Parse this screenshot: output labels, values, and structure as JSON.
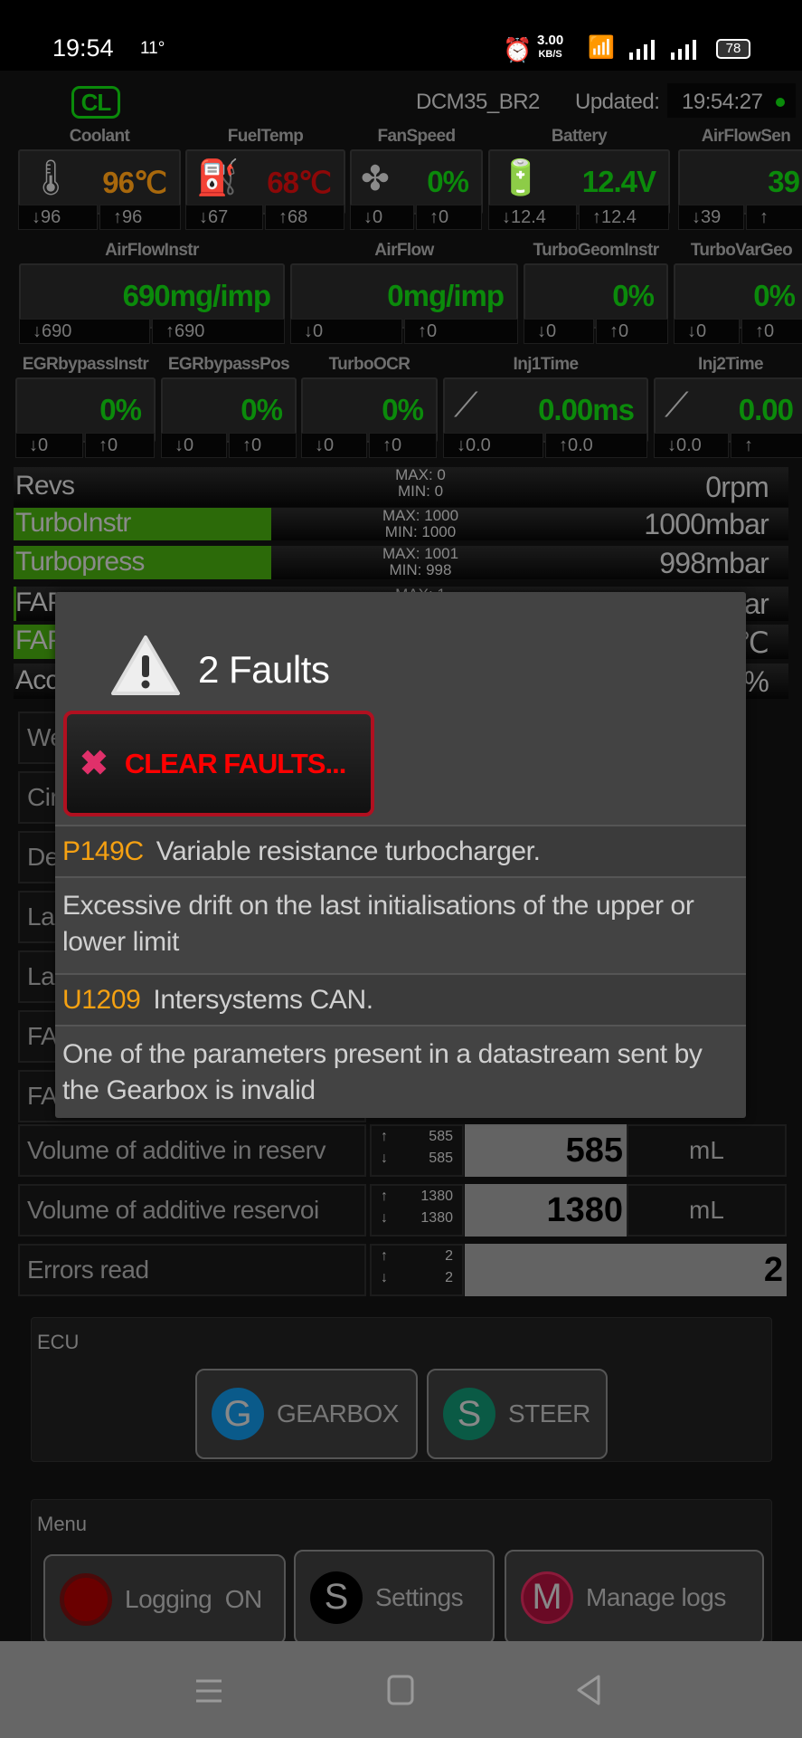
{
  "status_bar": {
    "time": "19:54",
    "temperature": "11°",
    "net_speed": "3.00",
    "net_unit": "KB/S",
    "battery": "78"
  },
  "header": {
    "logo": "CL",
    "ecu_name": "DCM35_BR2",
    "updated_label": "Updated:",
    "updated_time": "19:54:27",
    "connection_color": "#0a8a0a"
  },
  "gauges": [
    {
      "label": "Coolant",
      "value": "96℃",
      "min": "↓96",
      "max": "↑96",
      "icon": "coolant-temp-icon",
      "color": "#a8680c"
    },
    {
      "label": "FuelTemp",
      "value": "68℃",
      "min": "↓67",
      "max": "↑68",
      "icon": "fuel-pump-icon",
      "color": "#8c0808"
    },
    {
      "label": "FanSpeed",
      "value": "0%",
      "min": "↓0",
      "max": "↑0",
      "icon": "fan-icon",
      "color": "#0b8a0b"
    },
    {
      "label": "Battery",
      "value": "12.4V",
      "min": "↓12.4",
      "max": "↑12.4",
      "icon": "battery-icon",
      "color": "#0b8a0b"
    },
    {
      "label": "AirFlowSen",
      "value": "39",
      "min": "↓39",
      "max": "↑",
      "icon": "",
      "color": "#0b8a0b"
    },
    {
      "label": "AirFlowInstr",
      "value": "690mg/imp",
      "min": "↓690",
      "max": "↑690",
      "icon": "",
      "color": "#0b8a0b"
    },
    {
      "label": "AirFlow",
      "value": "0mg/imp",
      "min": "↓0",
      "max": "↑0",
      "icon": "",
      "color": "#0b8a0b"
    },
    {
      "label": "TurboGeomInstr",
      "value": "0%",
      "min": "↓0",
      "max": "↑0",
      "icon": "",
      "color": "#0b8a0b"
    },
    {
      "label": "TurboVarGeo",
      "value": "0%",
      "min": "↓0",
      "max": "↑0",
      "icon": "",
      "color": "#0b8a0b"
    },
    {
      "label": "EGRbypassInstr",
      "value": "0%",
      "min": "↓0",
      "max": "↑0",
      "icon": "",
      "color": "#0b8a0b"
    },
    {
      "label": "EGRbypassPos",
      "value": "0%",
      "min": "↓0",
      "max": "↑0",
      "icon": "",
      "color": "#0b8a0b"
    },
    {
      "label": "TurboOCR",
      "value": "0%",
      "min": "↓0",
      "max": "↑0",
      "icon": "",
      "color": "#0b8a0b"
    },
    {
      "label": "Inj1Time",
      "value": "0.00ms",
      "min": "↓0.0",
      "max": "↑0.0",
      "icon": "injector-icon",
      "color": "#0b8a0b"
    },
    {
      "label": "Inj2Time",
      "value": "0.00",
      "min": "↓0.0",
      "max": "↑",
      "icon": "injector-icon",
      "color": "#0b8a0b"
    }
  ],
  "bars": [
    {
      "label": "Revs",
      "max": "MAX: 0",
      "min": "MIN: 0",
      "value": "0rpm",
      "fill": 0
    },
    {
      "label": "TurboInstr",
      "max": "MAX: 1000",
      "min": "MIN: 1000",
      "value": "1000mbar",
      "fill": 1
    },
    {
      "label": "Turbopress",
      "max": "MAX: 1001",
      "min": "MIN: 998",
      "value": "998mbar",
      "fill": 1
    },
    {
      "label": "FAP",
      "max": "MAX: 1",
      "min": "",
      "value": "ar",
      "fill": 0.01
    },
    {
      "label": "FAP",
      "max": "",
      "min": "",
      "value": "℃",
      "fill": 1
    },
    {
      "label": "Acc",
      "max": "",
      "min": "",
      "value": "0%",
      "fill": 0
    }
  ],
  "params": [
    {
      "label": "We"
    },
    {
      "label": "Cir"
    },
    {
      "label": "De"
    },
    {
      "label": "Las"
    },
    {
      "label": "Las"
    },
    {
      "label": "FA"
    },
    {
      "label": "FA"
    },
    {
      "label": "Volume of additive in reserv",
      "max": "585",
      "min": "585",
      "value": "585",
      "unit": "mL"
    },
    {
      "label": "Volume of additive reservoi",
      "max": "1380",
      "min": "1380",
      "value": "1380",
      "unit": "mL"
    },
    {
      "label": "Errors read",
      "max": "2",
      "min": "2",
      "value": "2",
      "unit": ""
    }
  ],
  "ecu": {
    "title": "ECU",
    "buttons": [
      {
        "letter": "G",
        "label": "GEARBOX",
        "color": "#0a5a8a"
      },
      {
        "letter": "S",
        "label": "STEER",
        "color": "#0a5a45"
      }
    ]
  },
  "menu": {
    "title": "Menu",
    "buttons": [
      {
        "letter": "",
        "label": "Logging  ON",
        "color": "#6a0000"
      },
      {
        "letter": "S",
        "label": "Settings",
        "color": "#000000"
      },
      {
        "letter": "M",
        "label": "Manage logs",
        "color": "#6a0a25"
      }
    ]
  },
  "dialog": {
    "title": "2 Faults",
    "clear_button": "CLEAR FAULTS...",
    "faults": [
      {
        "code": "P149C",
        "name": "Variable resistance turbocharger.",
        "description": "Excessive drift on the last initialisations of the upper or lower limit"
      },
      {
        "code": "U1209",
        "name": "Intersystems CAN.",
        "description": "One of the parameters present in a datastream sent by the Gearbox is invalid"
      }
    ]
  }
}
